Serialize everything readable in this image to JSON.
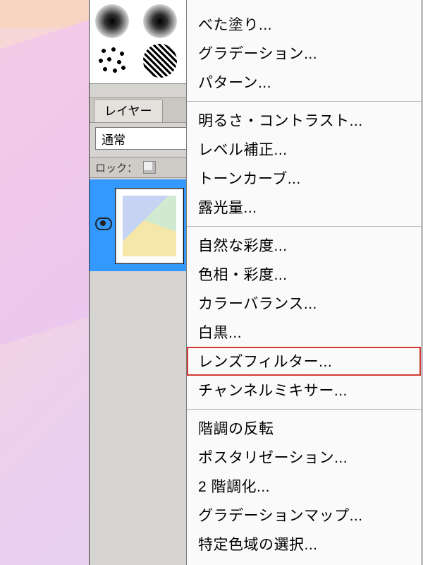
{
  "layers_panel": {
    "tab_label": "レイヤー",
    "blend_mode": "通常",
    "lock_label": "ロック：",
    "layer_visible": true
  },
  "menu": {
    "groups": [
      {
        "items": [
          {
            "name": "solid-color",
            "label": "べた塗り..."
          },
          {
            "name": "gradient",
            "label": "グラデーション..."
          },
          {
            "name": "pattern",
            "label": "パターン..."
          }
        ]
      },
      {
        "items": [
          {
            "name": "brightness-contrast",
            "label": "明るさ・コントラスト..."
          },
          {
            "name": "levels",
            "label": "レベル補正..."
          },
          {
            "name": "curves",
            "label": "トーンカーブ..."
          },
          {
            "name": "exposure",
            "label": "露光量..."
          }
        ]
      },
      {
        "items": [
          {
            "name": "vibrance",
            "label": "自然な彩度..."
          },
          {
            "name": "hue-saturation",
            "label": "色相・彩度..."
          },
          {
            "name": "color-balance",
            "label": "カラーバランス..."
          },
          {
            "name": "black-white",
            "label": "白黒..."
          },
          {
            "name": "photo-filter",
            "label": "レンズフィルター...",
            "highlight": true
          },
          {
            "name": "channel-mixer",
            "label": "チャンネルミキサー..."
          }
        ]
      },
      {
        "items": [
          {
            "name": "invert",
            "label": "階調の反転"
          },
          {
            "name": "posterize",
            "label": "ポスタリゼーション..."
          },
          {
            "name": "threshold",
            "label": "2 階調化..."
          },
          {
            "name": "gradient-map",
            "label": "グラデーションマップ..."
          },
          {
            "name": "selective-color",
            "label": "特定色域の選択..."
          }
        ]
      }
    ]
  }
}
